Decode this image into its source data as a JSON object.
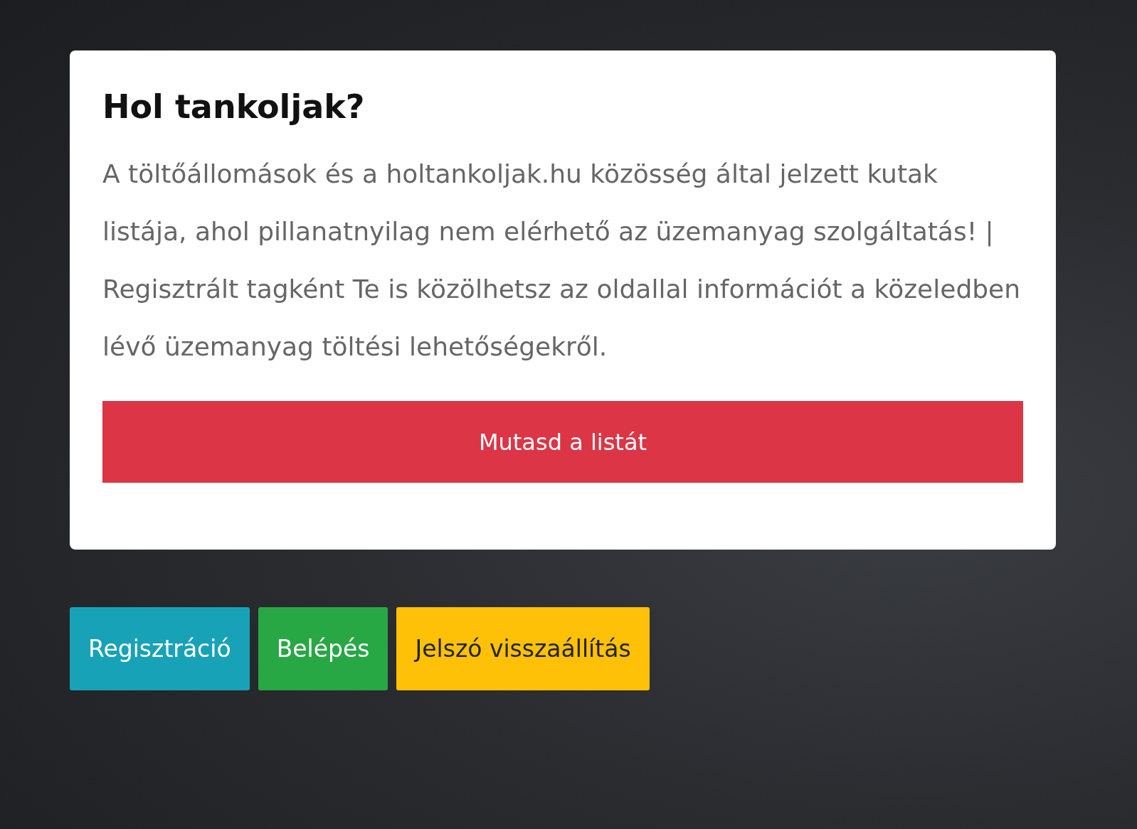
{
  "card": {
    "title": "Hol tankoljak?",
    "text": "A töltőállomások és a holtankoljak.hu közösség által jelzett kutak listája, ahol pillanatnyilag nem elérhető az üzemanyag szolgáltatás! | Regisztrált tagként Te is közölhetsz az oldallal információt a közeledben lévő üzemanyag töltési lehetőségekről.",
    "button": "Mutasd a listát"
  },
  "buttons": [
    {
      "label": "Regisztráció",
      "kind": "info"
    },
    {
      "label": "Belépés",
      "kind": "success"
    },
    {
      "label": "Jelszó visszaállítás",
      "kind": "warning"
    }
  ]
}
